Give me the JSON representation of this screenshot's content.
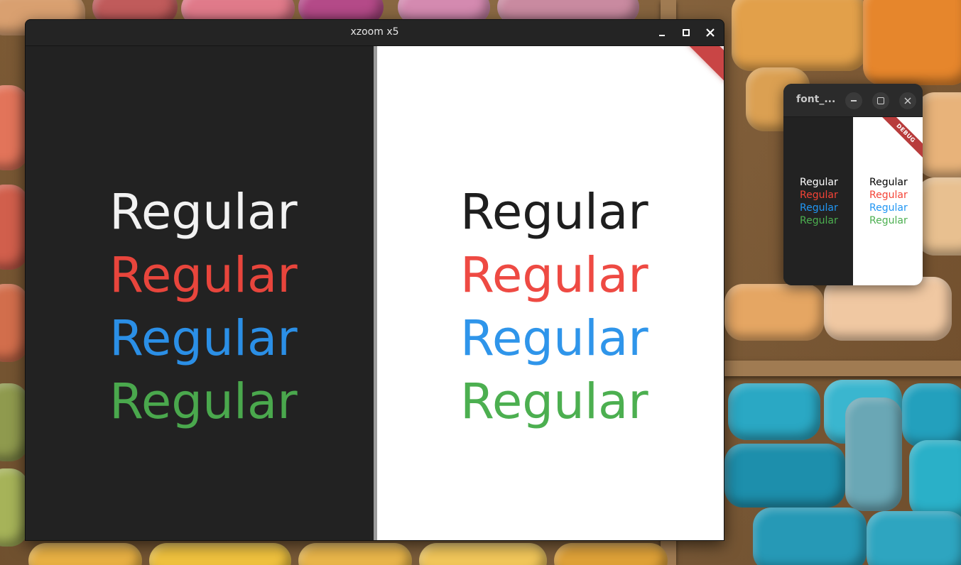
{
  "xzoom_window": {
    "title": "xzoom x5",
    "dark_pane_words": [
      {
        "text": "Regular",
        "color": "#f2f2f2"
      },
      {
        "text": "Regular",
        "color": "#e8453c"
      },
      {
        "text": "Regular",
        "color": "#2b8fe6"
      },
      {
        "text": "Regular",
        "color": "#4aa84d"
      }
    ],
    "light_pane_words": [
      {
        "text": "Regular",
        "color": "#1e1e1e"
      },
      {
        "text": "Regular",
        "color": "#ee4a43"
      },
      {
        "text": "Regular",
        "color": "#2f95ea"
      },
      {
        "text": "Regular",
        "color": "#4caf50"
      }
    ]
  },
  "flutter_window": {
    "title": "font_...",
    "debug_banner": "DEBUG",
    "dark_column_words": [
      {
        "text": "Regular",
        "color": "#ffffff"
      },
      {
        "text": "Regular",
        "color": "#f44336"
      },
      {
        "text": "Regular",
        "color": "#2196f3"
      },
      {
        "text": "Regular",
        "color": "#4caf50"
      }
    ],
    "light_column_words": [
      {
        "text": "Regular",
        "color": "#000000"
      },
      {
        "text": "Regular",
        "color": "#f44336"
      },
      {
        "text": "Regular",
        "color": "#2196f3"
      },
      {
        "text": "Regular",
        "color": "#4caf50"
      }
    ]
  },
  "icons": {
    "minimize": "minimize-icon",
    "maximize": "maximize-icon",
    "close": "close-icon"
  }
}
